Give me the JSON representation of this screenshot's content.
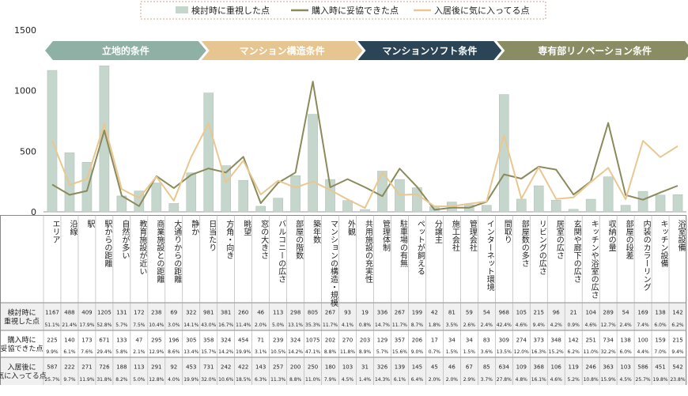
{
  "chart_data": {
    "type": "bar",
    "ylim": [
      0,
      1500
    ],
    "yticks": [
      0,
      500,
      1000,
      1500
    ],
    "grid": false,
    "legend_position": "top-center",
    "colors": {
      "bar": "#c5d6cd",
      "bar_border": "#a9c0b4",
      "line_compromise": "#8a8a5c",
      "line_satisfied": "#e8c890"
    },
    "series": [
      {
        "name": "検討時に重視した点",
        "type": "bar",
        "values": [
          1167,
          488,
          409,
          1205,
          131,
          172,
          238,
          69,
          322,
          981,
          381,
          260,
          46,
          113,
          298,
          805,
          267,
          93,
          19,
          336,
          267,
          199,
          42,
          81,
          59,
          54,
          968,
          105,
          215,
          96,
          21,
          104,
          289,
          54,
          169,
          138,
          142
        ]
      },
      {
        "name": "購入時に妥協できた点",
        "type": "line",
        "values": [
          225,
          140,
          173,
          671,
          133,
          47,
          295,
          196,
          305,
          358,
          324,
          454,
          71,
          239,
          324,
          1075,
          202,
          270,
          203,
          129,
          357,
          206,
          17,
          34,
          34,
          83,
          309,
          274,
          373,
          348,
          142,
          251,
          734,
          138,
          100,
          159,
          215
        ]
      },
      {
        "name": "入居後に気に入ってる点",
        "type": "line",
        "values": [
          587,
          222,
          271,
          726,
          188,
          113,
          291,
          92,
          453,
          731,
          242,
          422,
          143,
          257,
          200,
          250,
          180,
          103,
          31,
          326,
          139,
          145,
          45,
          46,
          67,
          85,
          634,
          109,
          368,
          106,
          119,
          246,
          363,
          103,
          586,
          451,
          542
        ]
      }
    ],
    "groups": [
      {
        "label": "立地的条件",
        "start": 0,
        "end": 8,
        "color": "#8fb1a5",
        "text_color": "#ffffff"
      },
      {
        "label": "マンション構造条件",
        "start": 9,
        "end": 17,
        "color": "#e6c590",
        "text_color": "#ffffff"
      },
      {
        "label": "マンションソフト条件",
        "start": 18,
        "end": 25,
        "color": "#2c4556",
        "text_color": "#ffffff"
      },
      {
        "label": "専有部リノベーション条件",
        "start": 26,
        "end": 36,
        "color": "#8a8c64",
        "text_color": "#ffffff"
      }
    ],
    "categories": [
      "エリア",
      "沿線",
      "駅",
      "駅からの距離",
      "自然が多い",
      "教育施設が近い",
      "商業施設との距離",
      "大通りからの距離",
      "静か",
      "日当たり",
      "方角・向き",
      "眺望",
      "窓の大きさ",
      "バルコニーの広さ",
      "部屋の階数",
      "築年数",
      "マンションの構造・規模",
      "外観",
      "共用施設の充実性",
      "管理体制",
      "駐車場の有無",
      "ペットが飼える",
      "分譲主",
      "施工会社",
      "管理会社",
      "インターネット環境",
      "間取り",
      "部屋数の多さ",
      "リビングの広さ",
      "居室の広さ",
      "玄関や廊下の広さ",
      "キッチンや浴室の広さ",
      "収納の量",
      "部屋の段差",
      "内装のカラーリング",
      "キッチン設備",
      "浴室設備"
    ],
    "table_rows": [
      {
        "label": "検討時に\n重視した点",
        "values": [
          "1167",
          "488",
          "409",
          "1205",
          "131",
          "172",
          "238",
          "69",
          "322",
          "981",
          "381",
          "260",
          "46",
          "113",
          "298",
          "805",
          "267",
          "93",
          "19",
          "336",
          "267",
          "199",
          "42",
          "81",
          "59",
          "54",
          "968",
          "105",
          "215",
          "96",
          "21",
          "104",
          "289",
          "54",
          "169",
          "138",
          "142"
        ],
        "pcts": [
          "51.1%",
          "21.4%",
          "17.9%",
          "52.8%",
          "5.7%",
          "7.5%",
          "10.4%",
          "3.0%",
          "14.1%",
          "43.0%",
          "16.7%",
          "11.4%",
          "2.0%",
          "5.0%",
          "13.1%",
          "35.3%",
          "11.7%",
          "4.1%",
          "0.8%",
          "14.7%",
          "11.7%",
          "8.7%",
          "1.8%",
          "3.5%",
          "2.6%",
          "2.4%",
          "42.4%",
          "4.6%",
          "9.4%",
          "4.2%",
          "0.9%",
          "4.6%",
          "12.7%",
          "2.4%",
          "7.4%",
          "6.0%",
          "6.2%"
        ]
      },
      {
        "label": "購入時に\n妥協できた点",
        "values": [
          "225",
          "140",
          "173",
          "671",
          "133",
          "47",
          "295",
          "196",
          "305",
          "358",
          "324",
          "454",
          "71",
          "239",
          "324",
          "1075",
          "202",
          "270",
          "203",
          "129",
          "357",
          "206",
          "17",
          "34",
          "34",
          "83",
          "309",
          "274",
          "373",
          "348",
          "142",
          "251",
          "734",
          "138",
          "100",
          "159",
          "215"
        ],
        "pcts": [
          "9.9%",
          "6.1%",
          "7.6%",
          "29.4%",
          "5.8%",
          "2.1%",
          "12.9%",
          "8.6%",
          "13.4%",
          "15.7%",
          "14.2%",
          "19.9%",
          "3.1%",
          "10.5%",
          "14.2%",
          "47.1%",
          "8.8%",
          "11.8%",
          "8.9%",
          "5.7%",
          "15.6%",
          "9.0%",
          "0.7%",
          "1.5%",
          "1.5%",
          "3.6%",
          "13.5%",
          "12.0%",
          "16.3%",
          "15.2%",
          "6.2%",
          "11.0%",
          "32.2%",
          "6.0%",
          "4.4%",
          "7.0%",
          "9.4%"
        ]
      },
      {
        "label": "入居後に\n気に入ってる点",
        "values": [
          "587",
          "222",
          "271",
          "726",
          "188",
          "113",
          "291",
          "92",
          "453",
          "731",
          "242",
          "422",
          "143",
          "257",
          "200",
          "250",
          "180",
          "103",
          "31",
          "326",
          "139",
          "145",
          "45",
          "46",
          "67",
          "85",
          "634",
          "109",
          "368",
          "106",
          "119",
          "246",
          "363",
          "103",
          "586",
          "451",
          "542"
        ],
        "pcts": [
          "25.7%",
          "9.7%",
          "11.9%",
          "31.8%",
          "8.2%",
          "5.0%",
          "12.8%",
          "4.0%",
          "19.9%",
          "32.0%",
          "10.6%",
          "18.5%",
          "6.3%",
          "11.3%",
          "8.8%",
          "11.0%",
          "7.9%",
          "4.5%",
          "1.4%",
          "14.3%",
          "6.1%",
          "6.4%",
          "2.0%",
          "2.0%",
          "2.9%",
          "3.7%",
          "27.8%",
          "4.8%",
          "16.1%",
          "4.6%",
          "5.2%",
          "10.8%",
          "15.9%",
          "4.5%",
          "25.7%",
          "19.8%",
          "23.8%"
        ]
      }
    ]
  }
}
